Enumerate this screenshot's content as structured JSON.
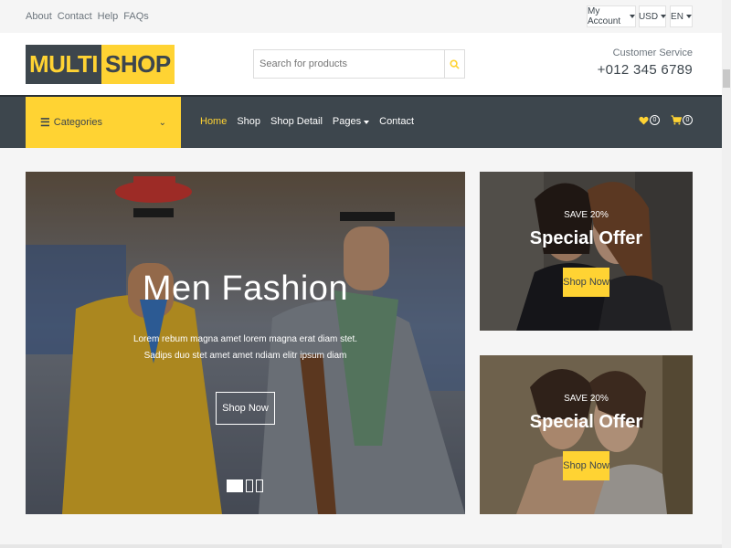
{
  "topbar": {
    "links": [
      "About",
      "Contact",
      "Help",
      "FAQs"
    ],
    "account": "My Account",
    "currency": "USD",
    "language": "EN"
  },
  "header": {
    "logo_part1": "MULTI",
    "logo_part2": "SHOP",
    "search_placeholder": "Search for products",
    "service_title": "Customer Service",
    "service_phone": "+012 345 6789"
  },
  "nav": {
    "categories_label": "Categories",
    "links": [
      "Home",
      "Shop",
      "Shop Detail",
      "Pages",
      "Contact"
    ],
    "active": "Home",
    "wishlist_count": "0",
    "cart_count": "0"
  },
  "carousel": {
    "title": "Men Fashion",
    "description": "Lorem rebum magna amet lorem magna erat diam stet. Sadips duo stet amet amet ndiam elitr ipsum diam",
    "button": "Shop Now",
    "active_slide": 1,
    "slide_count": 3
  },
  "offers": [
    {
      "save": "SAVE 20%",
      "title": "Special Offer",
      "button": "Shop Now"
    },
    {
      "save": "SAVE 20%",
      "title": "Special Offer",
      "button": "Shop Now"
    }
  ],
  "colors": {
    "primary": "#ffd333",
    "dark": "#3d464d",
    "muted": "#6c757d"
  }
}
